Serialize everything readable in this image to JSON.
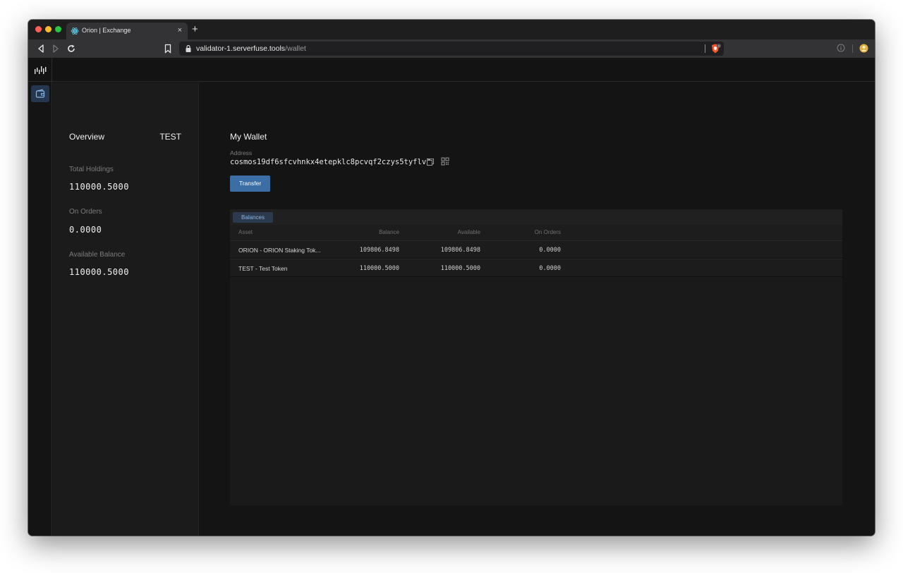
{
  "browser": {
    "tab_title": "Orion | Exchange",
    "tab_close": "×",
    "new_tab": "+",
    "url_host": "validator-1.serverfuse.tools",
    "url_path": "/wallet"
  },
  "overview": {
    "title": "Overview",
    "symbol": "TEST",
    "total_holdings_label": "Total Holdings",
    "total_holdings_value": "110000.5000",
    "on_orders_label": "On Orders",
    "on_orders_value": "0.0000",
    "available_label": "Available Balance",
    "available_value": "110000.5000"
  },
  "wallet": {
    "title": "My Wallet",
    "address_label": "Address",
    "address_value": "cosmos19df6sfcvhnkx4etepklc8pcvqf2czys5tyflv2",
    "transfer_label": "Transfer"
  },
  "balances": {
    "tab_label": "Balances",
    "headers": [
      "Asset",
      "Balance",
      "Available",
      "On Orders"
    ],
    "rows": [
      [
        "ORION - ORION Staking Tok...",
        "109806.8498",
        "109806.8498",
        "0.0000"
      ],
      [
        "TEST - Test Token",
        "110000.5000",
        "110000.5000",
        "0.0000"
      ]
    ]
  },
  "colors": {
    "accent": "#3a6ea5",
    "background": "#141414",
    "panel": "#1b1b1b"
  },
  "icons": [
    "back-icon",
    "forward-icon",
    "reload-icon",
    "bookmark-icon",
    "lock-icon",
    "brave-shield-icon",
    "info-icon",
    "profile-icon",
    "logo-icon",
    "wallet-icon",
    "copy-icon",
    "qr-icon"
  ]
}
